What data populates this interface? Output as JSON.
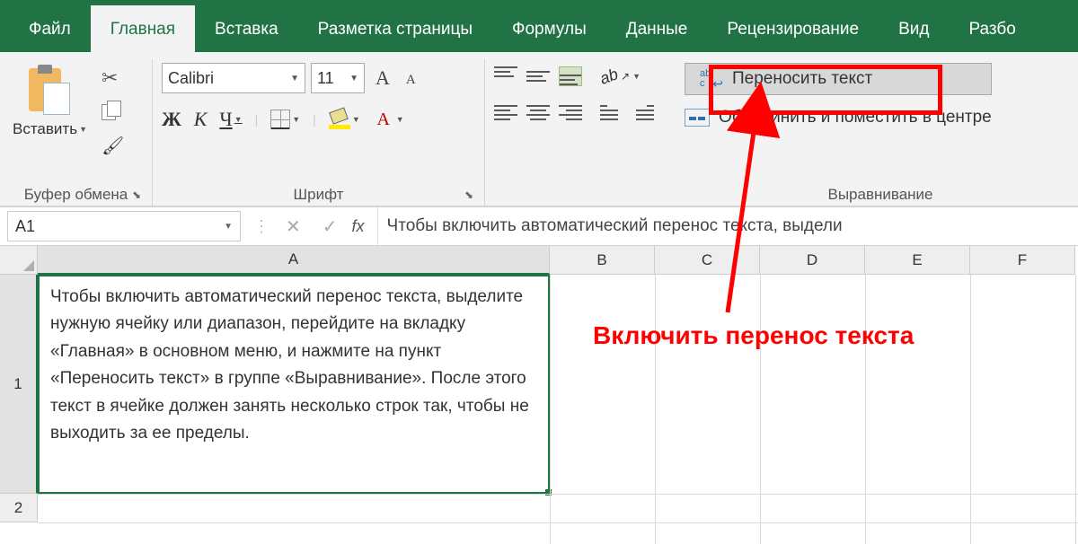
{
  "tabs": {
    "file": "Файл",
    "home": "Главная",
    "insert": "Вставка",
    "page_layout": "Разметка страницы",
    "formulas": "Формулы",
    "data": "Данные",
    "review": "Рецензирование",
    "view": "Вид",
    "developer": "Разбо"
  },
  "ribbon": {
    "clipboard": {
      "paste": "Вставить",
      "label": "Буфер обмена"
    },
    "font": {
      "name": "Calibri",
      "size": "11",
      "bold": "Ж",
      "italic": "К",
      "underline": "Ч",
      "label": "Шрифт",
      "increase": "A",
      "decrease": "A"
    },
    "alignment": {
      "wrap": "Переносить текст",
      "merge": "Объединить и поместить в центре",
      "label": "Выравнивание"
    }
  },
  "formula_bar": {
    "name_box": "A1",
    "fx": "fx",
    "content": "Чтобы включить автоматический перенос текста, выдели"
  },
  "columns": [
    "A",
    "B",
    "C",
    "D",
    "E",
    "F"
  ],
  "rows": [
    "1",
    "2"
  ],
  "cell_A1": "Чтобы включить автоматический перенос текста, выделите нужную ячейку или диапазон, перейдите на вкладку «Главная» в основном меню, и нажмите на пункт «Переносить текст» в группе «Выравнивание». После этого текст в ячейке должен занять несколько строк так, чтобы не выходить за ее пределы.",
  "annotation": "Включить перенос текста"
}
